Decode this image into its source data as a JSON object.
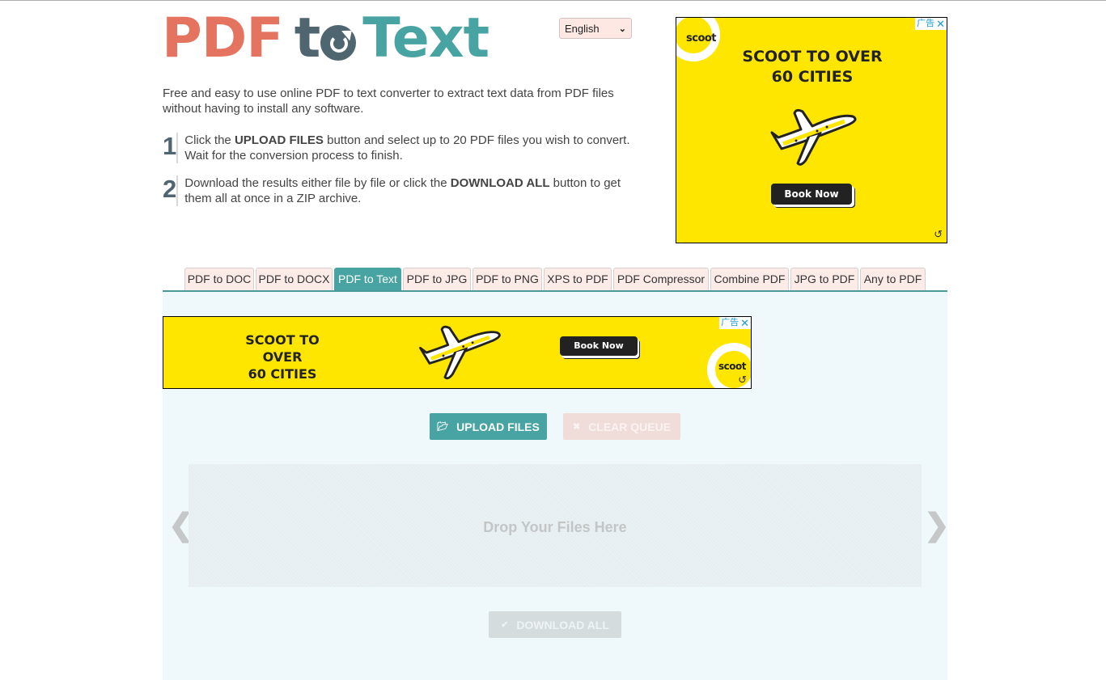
{
  "logo": {
    "part1": "PDF",
    "part2_t": "t",
    "part3": "Text",
    "alt": "PDF to Text"
  },
  "language_select": {
    "selected": "English"
  },
  "intro": "Free and easy to use online PDF to text converter to extract text data from PDF files without having to install any software.",
  "steps": [
    {
      "number": "1",
      "before": "Click the ",
      "bold": "UPLOAD FILES",
      "after": " button and select up to 20 PDF files you wish to convert. Wait for the conversion process to finish."
    },
    {
      "number": "2",
      "before": "Download the results either file by file or click the ",
      "bold": "DOWNLOAD ALL",
      "after": " button to get them all at once in a ZIP archive."
    }
  ],
  "ad_square": {
    "brand": "scoot",
    "headline_line1": "SCOOT TO OVER",
    "headline_line2": "60 CITIES",
    "cta": "Book Now",
    "adchoice_label": "广告",
    "close": "✕",
    "refresh": "↺"
  },
  "tabs": [
    {
      "label": "PDF to DOC",
      "active": false
    },
    {
      "label": "PDF to DOCX",
      "active": false
    },
    {
      "label": "PDF to Text",
      "active": true
    },
    {
      "label": "PDF to JPG",
      "active": false
    },
    {
      "label": "PDF to PNG",
      "active": false
    },
    {
      "label": "XPS to PDF",
      "active": false
    },
    {
      "label": "PDF Compressor",
      "active": false
    },
    {
      "label": "Combine PDF",
      "active": false
    },
    {
      "label": "JPG to PDF",
      "active": false
    },
    {
      "label": "Any to PDF",
      "active": false
    }
  ],
  "ad_banner": {
    "brand": "scoot",
    "headline_line1": "SCOOT TO OVER",
    "headline_line2": "60 CITIES",
    "cta": "Book Now",
    "adchoice_label": "广告",
    "close": "✕",
    "refresh": "↺"
  },
  "buttons": {
    "upload": "UPLOAD FILES",
    "clear": "CLEAR QUEUE",
    "download_all": "DOWNLOAD ALL"
  },
  "dropzone": {
    "label": "Drop Your Files Here"
  },
  "nav": {
    "prev": "❮",
    "next": "❯"
  },
  "colors": {
    "coral": "#e4735f",
    "slate": "#4f6570",
    "teal": "#48a3a3",
    "ad_yellow": "#ffe600"
  }
}
